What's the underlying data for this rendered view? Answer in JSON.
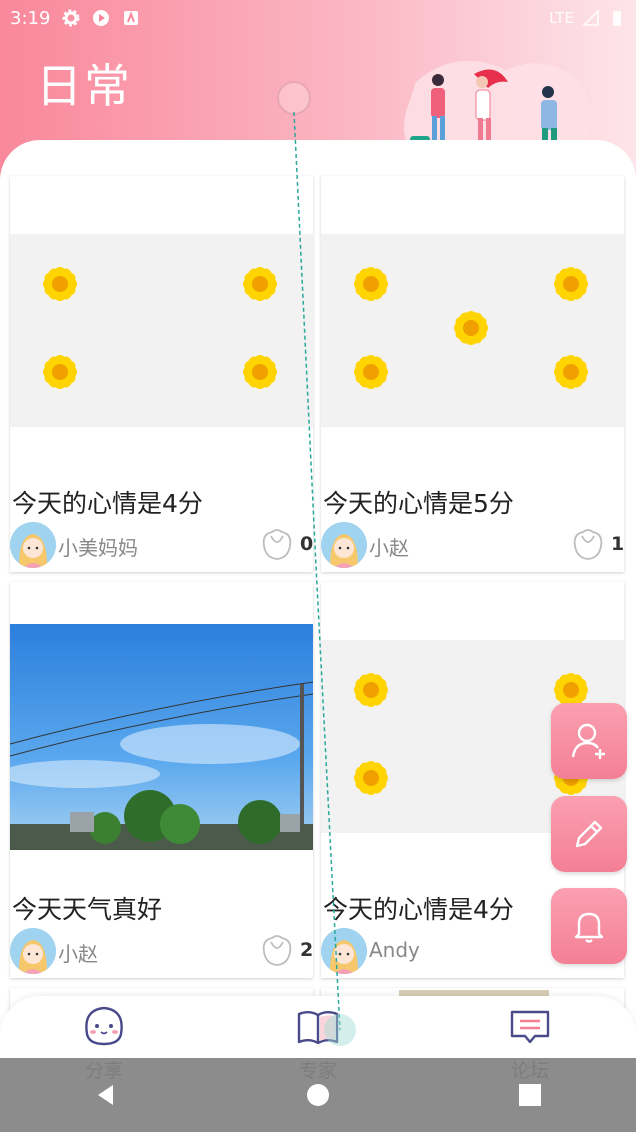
{
  "status": {
    "time": "3:19",
    "network": "LTE"
  },
  "header": {
    "title": "日常"
  },
  "posts": [
    {
      "title": "今天的心情是4分",
      "author": "小美妈妈",
      "likes": "0",
      "image": "sunflowers-4"
    },
    {
      "title": "今天的心情是5分",
      "author": "小赵",
      "likes": "1",
      "image": "sunflowers-5"
    },
    {
      "title": "今天天气真好",
      "author": "小赵",
      "likes": "2",
      "image": "sky-photo"
    },
    {
      "title": "今天的心情是4分",
      "author": "Andy",
      "likes": "",
      "image": "sunflowers-4"
    }
  ],
  "fabs": [
    {
      "icon": "add-user-icon"
    },
    {
      "icon": "edit-icon"
    },
    {
      "icon": "bell-icon"
    }
  ],
  "nav": {
    "share": "分享",
    "expert": "专家",
    "forum": "论坛"
  },
  "colors": {
    "accent": "#f47f95",
    "header_start": "#f9889b",
    "header_end": "#fde5ea"
  }
}
